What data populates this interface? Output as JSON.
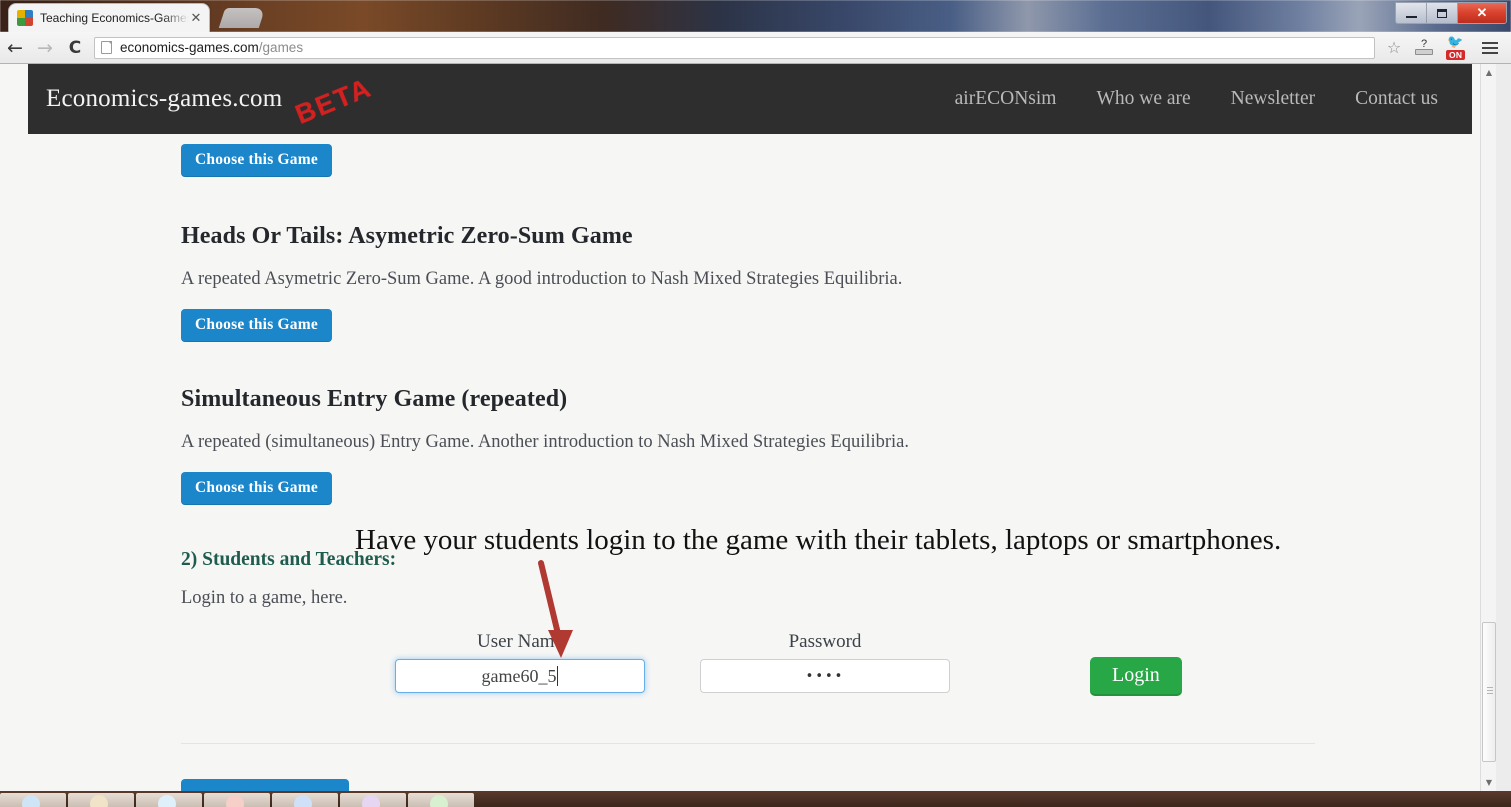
{
  "window": {
    "minimize_label": "Minimize",
    "maximize_label": "Maximize",
    "close_label": "✕"
  },
  "browser": {
    "tab": {
      "title": "Teaching Economics-Games",
      "close_label": "✕",
      "favicon_name": "site-favicon"
    },
    "new_tab_label": "",
    "back_label": "←",
    "forward_label": "→",
    "reload_label": "C",
    "url_main": "economics-games.com",
    "url_path": "/games",
    "bookmark_star": "☆",
    "extension_pdf_label": "?",
    "extension_on_badge": "ON",
    "menu_label": "Menu"
  },
  "site": {
    "brand": "Economics-games.com",
    "beta_stamp": "BETA",
    "nav": [
      {
        "label": "airECONsim"
      },
      {
        "label": "Who we are"
      },
      {
        "label": "Newsletter"
      },
      {
        "label": "Contact us"
      }
    ]
  },
  "main": {
    "top_button_label": "Choose this Game",
    "games": [
      {
        "title": "Heads Or Tails: Asymetric Zero-Sum Game",
        "desc": "A repeated Asymetric Zero-Sum Game. A good introduction to Nash Mixed Strategies Equilibria.",
        "button_label": "Choose this Game"
      },
      {
        "title": "Simultaneous Entry Game (repeated)",
        "desc": "A repeated (simultaneous) Entry Game. Another introduction to Nash Mixed Strategies Equilibria.",
        "button_label": "Choose this Game"
      }
    ],
    "section": {
      "title": "2) Students and Teachers:",
      "subtitle": "Login to a game, here."
    },
    "login": {
      "username_label": "User Name",
      "username_value": "game60_5",
      "username_placeholder": "",
      "password_label": "Password",
      "password_value": "••••",
      "password_placeholder": "",
      "login_button_label": "Login"
    }
  },
  "annotation": {
    "text": "Have your students login to the game with their tablets, laptops or smartphones.",
    "arrow_color": "#b03a32"
  },
  "colors": {
    "header_bg": "#2e2e2e",
    "primary_button": "#1b86c9",
    "login_button": "#27a745",
    "section_title": "#1f5c4d",
    "beta_red": "#e02020"
  }
}
